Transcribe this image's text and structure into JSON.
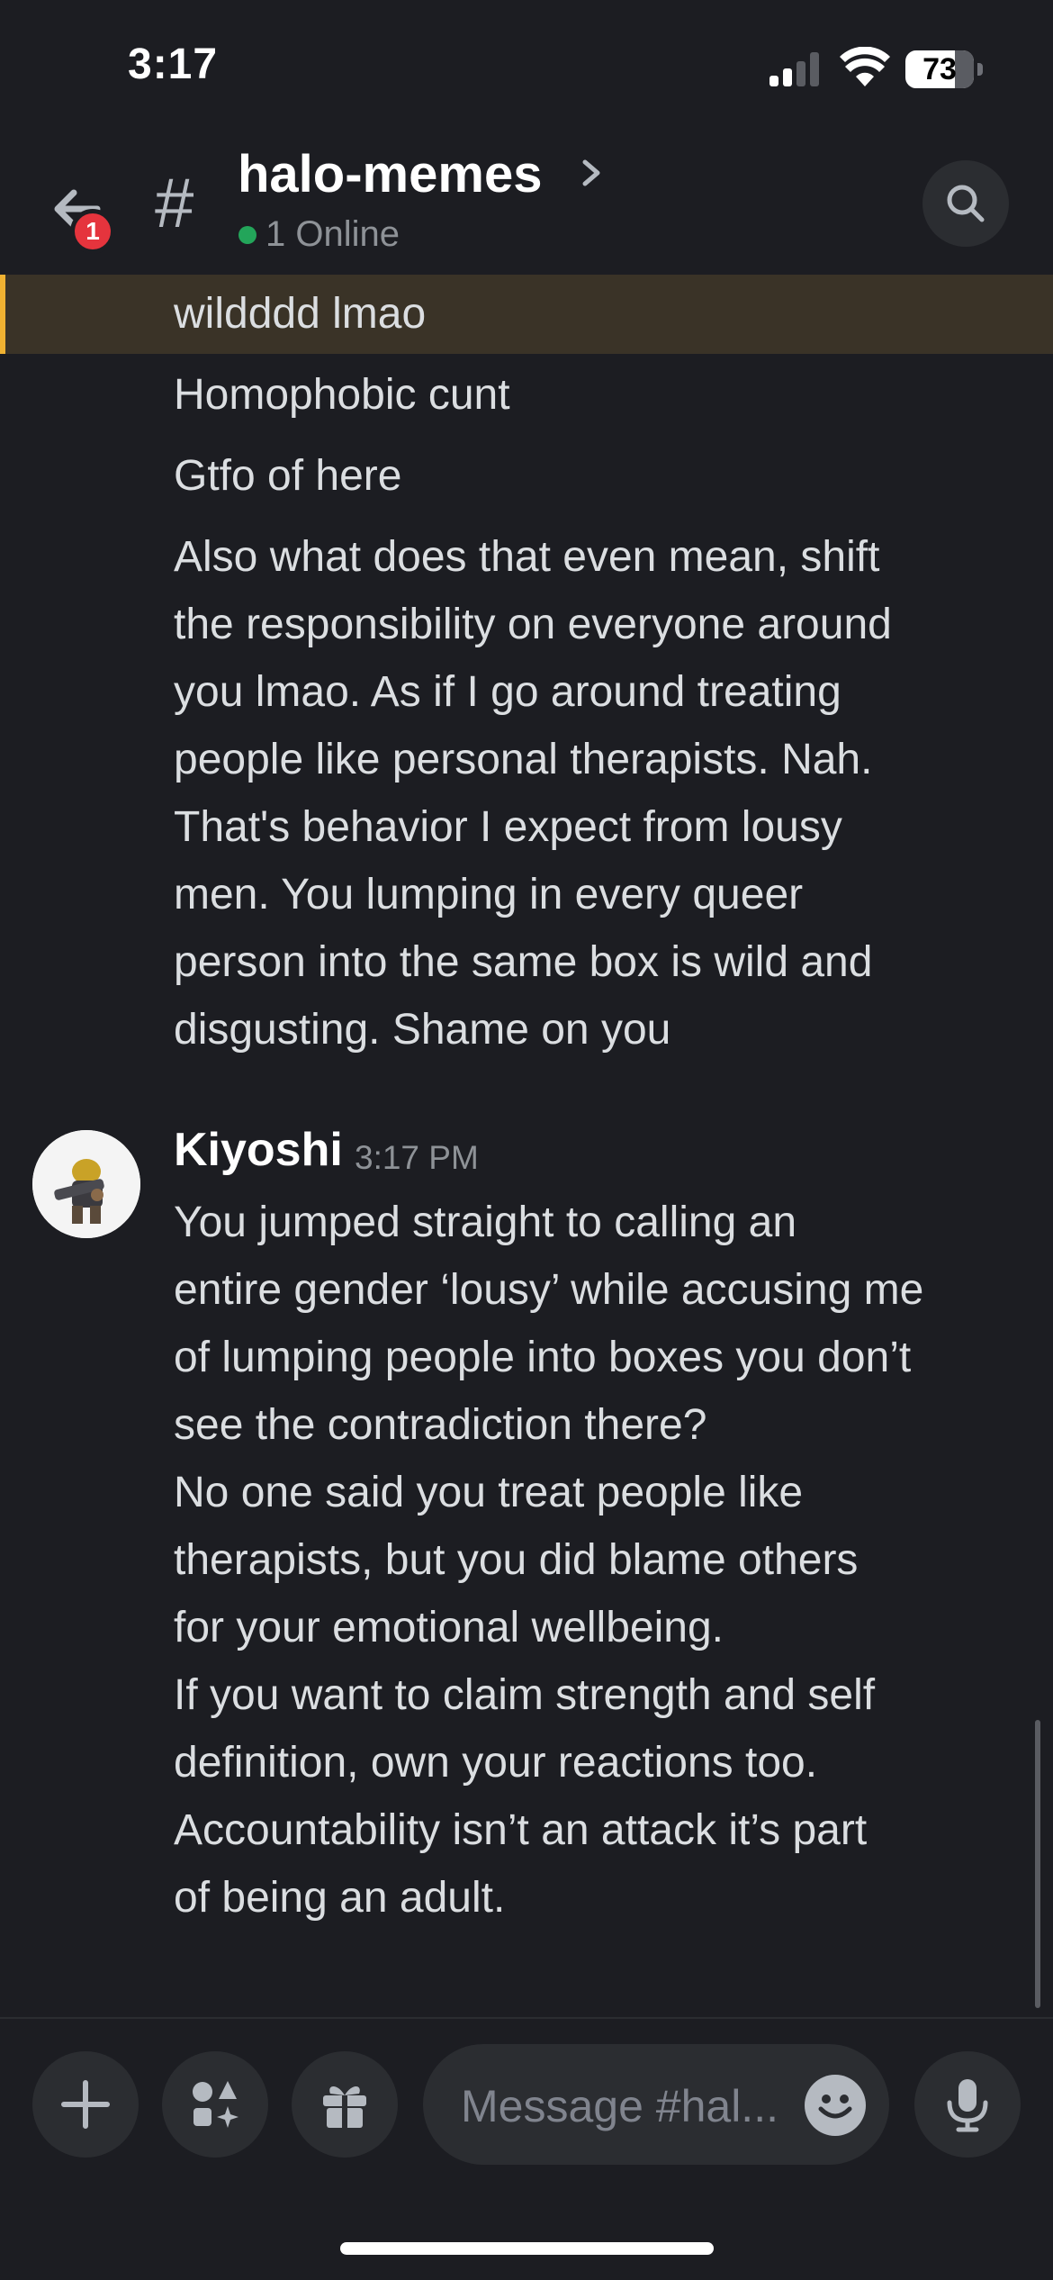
{
  "status_bar": {
    "time": "3:17",
    "battery": "73",
    "battery_level": 0.73,
    "signal_bars": 2
  },
  "header": {
    "channel_name": "halo-memes",
    "online_count": "1 Online",
    "back_badge_count": "1"
  },
  "previous_messages": [
    "wildddd lmao",
    "Homophobic cunt",
    "Gtfo of here",
    "Also what does that even mean, shift",
    "the responsibility on everyone around",
    "you lmao. As if I go around treating",
    "people like personal therapists. Nah.",
    "That's behavior I expect from lousy",
    "men. You lumping in every queer",
    "person into the same box is wild and",
    "disgusting. Shame on you"
  ],
  "reply": {
    "author": "Kiyoshi",
    "timestamp": "3:17 PM",
    "lines": [
      "You jumped straight to calling an",
      "entire gender ‘lousy’ while accusing me",
      "of lumping people into boxes you don’t",
      "see the contradiction there?",
      "No one said you treat people like",
      "therapists, but you did blame others",
      "for your emotional wellbeing.",
      "If you want to claim strength and self",
      "definition, own your reactions too.",
      "Accountability isn’t an attack it’s part",
      "of being an adult."
    ]
  },
  "composer": {
    "placeholder": "Message #hal..."
  },
  "icons": {
    "back": "arrow-left-icon",
    "channel": "hash-icon",
    "chevron": "chevron-right-icon",
    "search": "search-icon",
    "add": "plus-icon",
    "apps": "apps-icon",
    "gift": "gift-icon",
    "emoji": "emoji-icon",
    "mic": "microphone-icon"
  },
  "colors": {
    "background": "#1c1d22",
    "highlight": "#3a3327",
    "highlight_border": "#f0b232",
    "online": "#23a55a",
    "badge": "#e5343d"
  }
}
